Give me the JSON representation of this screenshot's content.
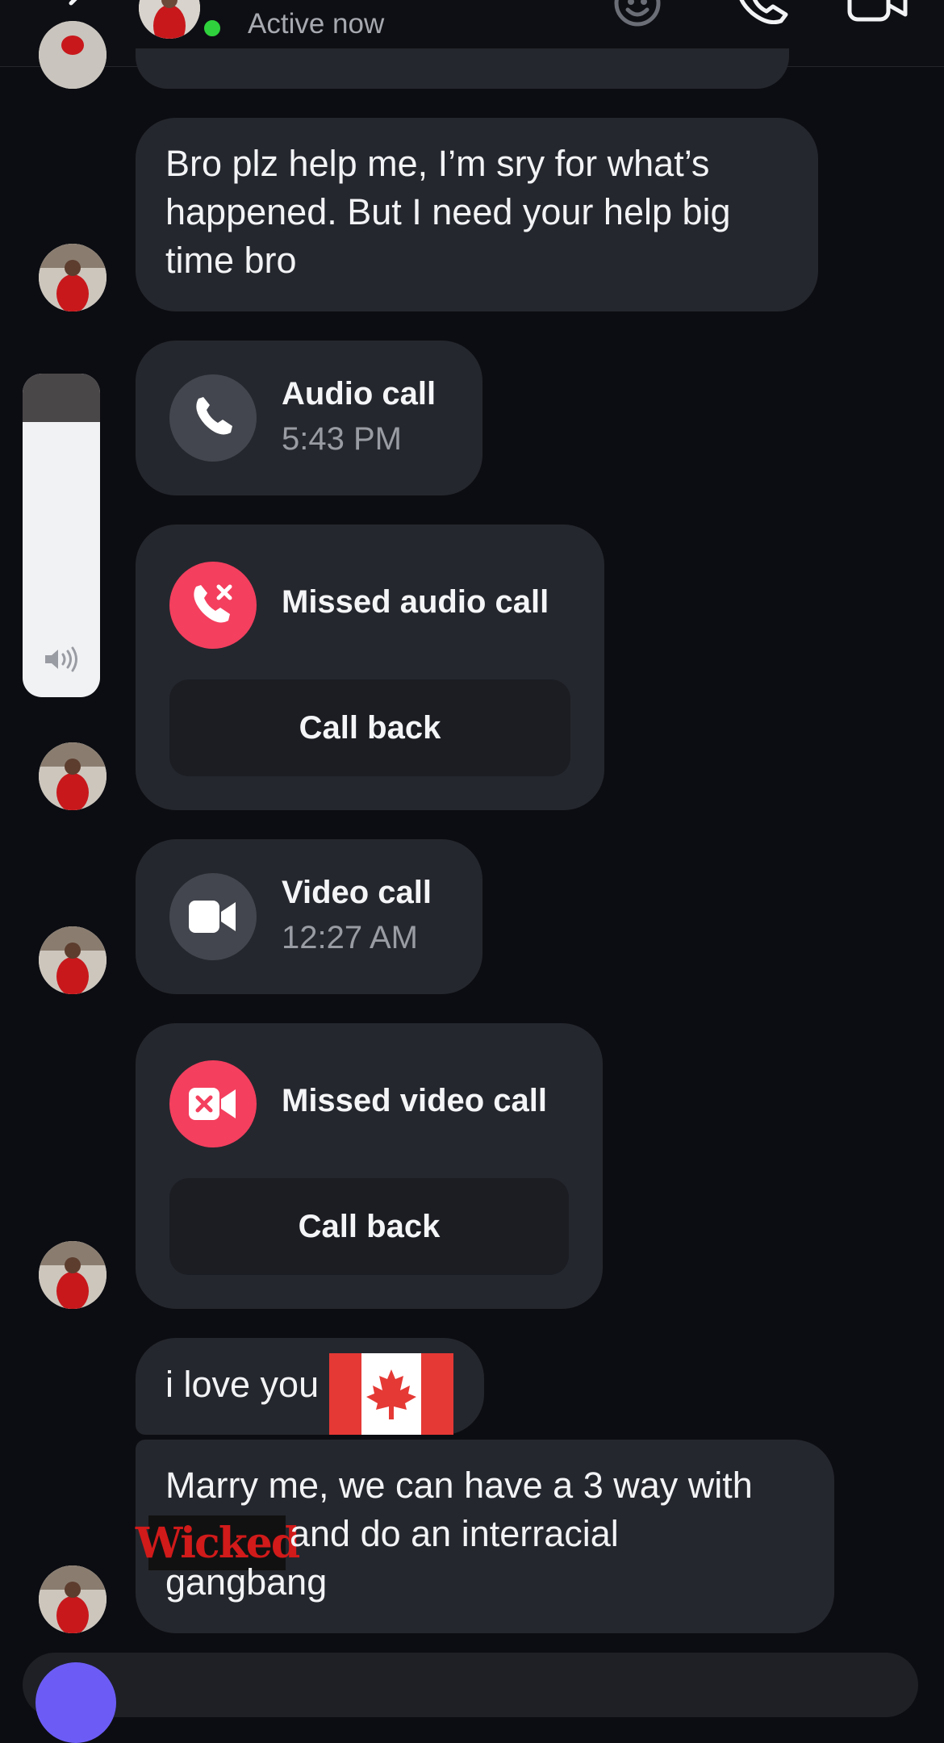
{
  "header": {
    "status_text": "Active now",
    "online_color": "#2fd13c",
    "icons": [
      "back-arrow-icon",
      "sticker-face-icon",
      "phone-icon",
      "video-camera-icon"
    ]
  },
  "messages": [
    {
      "kind": "text",
      "text": "Bro plz help me, I’m sry for what’s happened. But I need your help big time bro"
    },
    {
      "kind": "call",
      "title": "Audio call",
      "time": "5:43 PM",
      "icon": "phone-icon"
    },
    {
      "kind": "missed_call",
      "title": "Missed audio call",
      "action": "Call back",
      "icon": "missed-call-icon"
    },
    {
      "kind": "call",
      "title": "Video call",
      "time": "12:27 AM",
      "icon": "video-camera-icon"
    },
    {
      "kind": "missed_call",
      "title": "Missed video call",
      "action": "Call back",
      "icon": "missed-video-icon"
    },
    {
      "kind": "text",
      "text": "i love you",
      "sticker": "canada-flag"
    },
    {
      "kind": "text",
      "text_line1": "Marry me, we can have a 3 way with",
      "sticker_text": "Wicked",
      "text_line2": "and do an interracial",
      "text_line3": "gangbang"
    }
  ],
  "overlay": {
    "volume_icon": "speaker-icon"
  },
  "colors": {
    "background": "#0c0d12",
    "bubble": "#25272e",
    "missed": "#f43f5e",
    "accent": "#6c5cf5"
  }
}
